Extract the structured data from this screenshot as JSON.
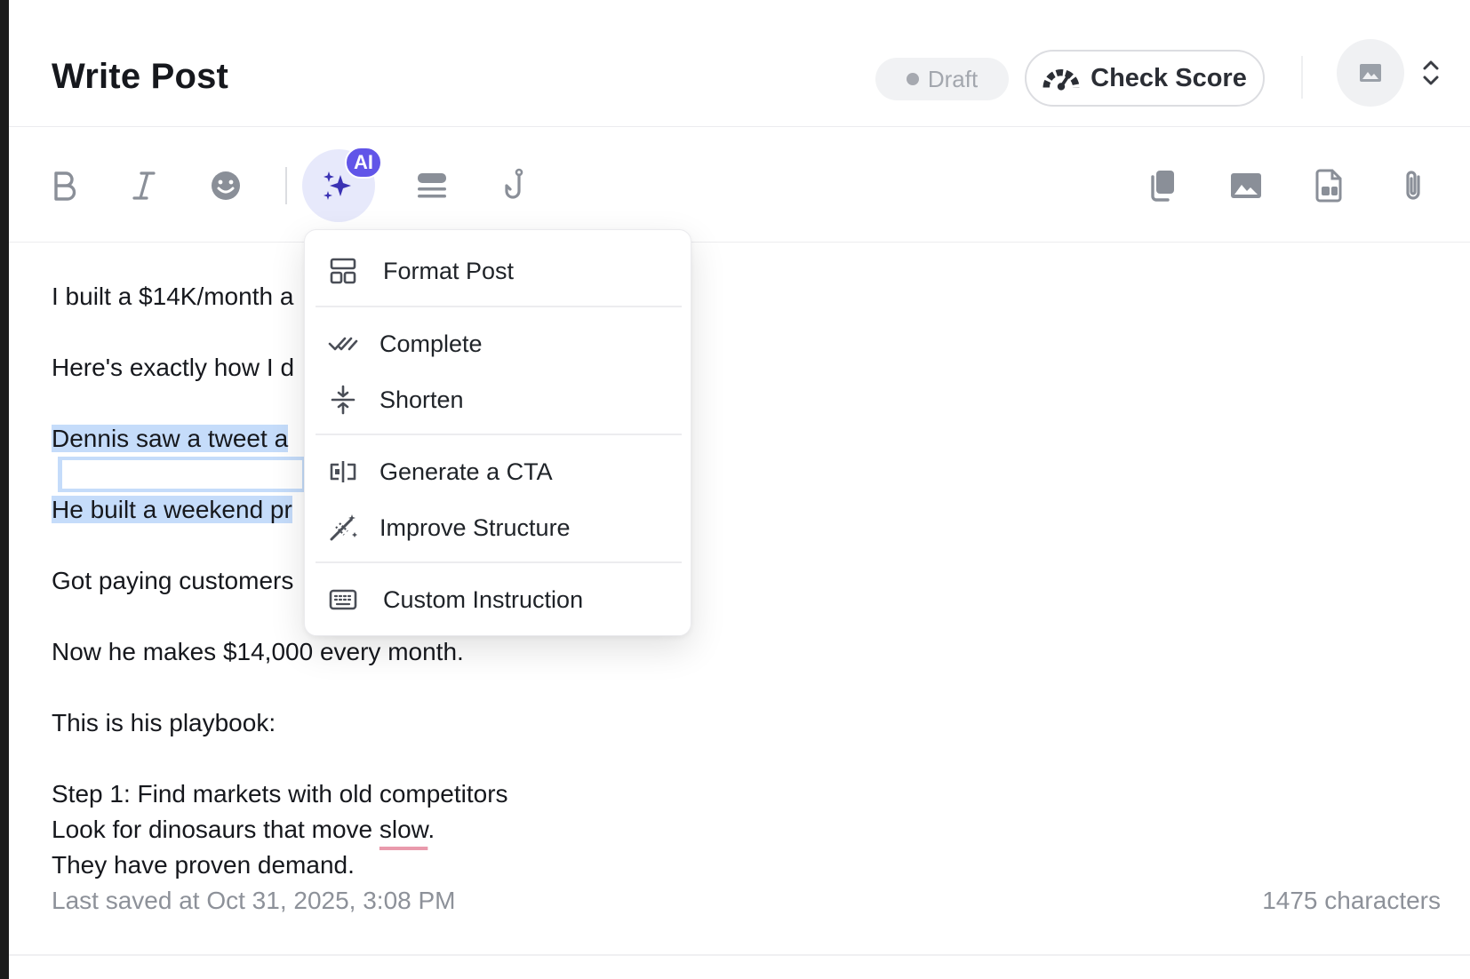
{
  "header": {
    "title": "Write Post",
    "status_badge": "Draft",
    "check_score_label": "Check Score"
  },
  "toolbar": {
    "ai_badge": "AI",
    "icons": [
      "bold-icon",
      "italic-icon",
      "emoji-icon",
      "ai-sparkle-icon",
      "format-lines-icon",
      "hook-icon",
      "copy-icon",
      "image-icon",
      "gif-file-icon",
      "paperclip-icon"
    ]
  },
  "editor": {
    "lines": [
      "I built a $14K/month a",
      "Here's exactly how I d",
      "Dennis saw a tweet a",
      "He built a weekend pr",
      "Got paying customers",
      "Now he makes $14,000 every month.",
      "This is his playbook:",
      "Step 1: Find markets with old competitors",
      "Look for dinosaurs that move ",
      "slow",
      ".",
      "They have proven demand."
    ],
    "last_saved": "Last saved at Oct 31, 2025, 3:08 PM",
    "char_count": "1475 characters"
  },
  "ai_menu": {
    "items": [
      {
        "label": "Format Post",
        "icon": "layout-icon"
      },
      {
        "label": "Complete",
        "icon": "double-check-icon"
      },
      {
        "label": "Shorten",
        "icon": "compress-icon"
      },
      {
        "label": "Generate a CTA",
        "icon": "cta-icon"
      },
      {
        "label": "Improve Structure",
        "icon": "magic-wand-icon"
      },
      {
        "label": "Custom Instruction",
        "icon": "keyboard-icon"
      }
    ]
  },
  "colors": {
    "accent": "#6155e8",
    "ai_button_bg": "#e7e9fb",
    "selection": "#c5dcfa",
    "spellcheck": "#e99aac"
  }
}
